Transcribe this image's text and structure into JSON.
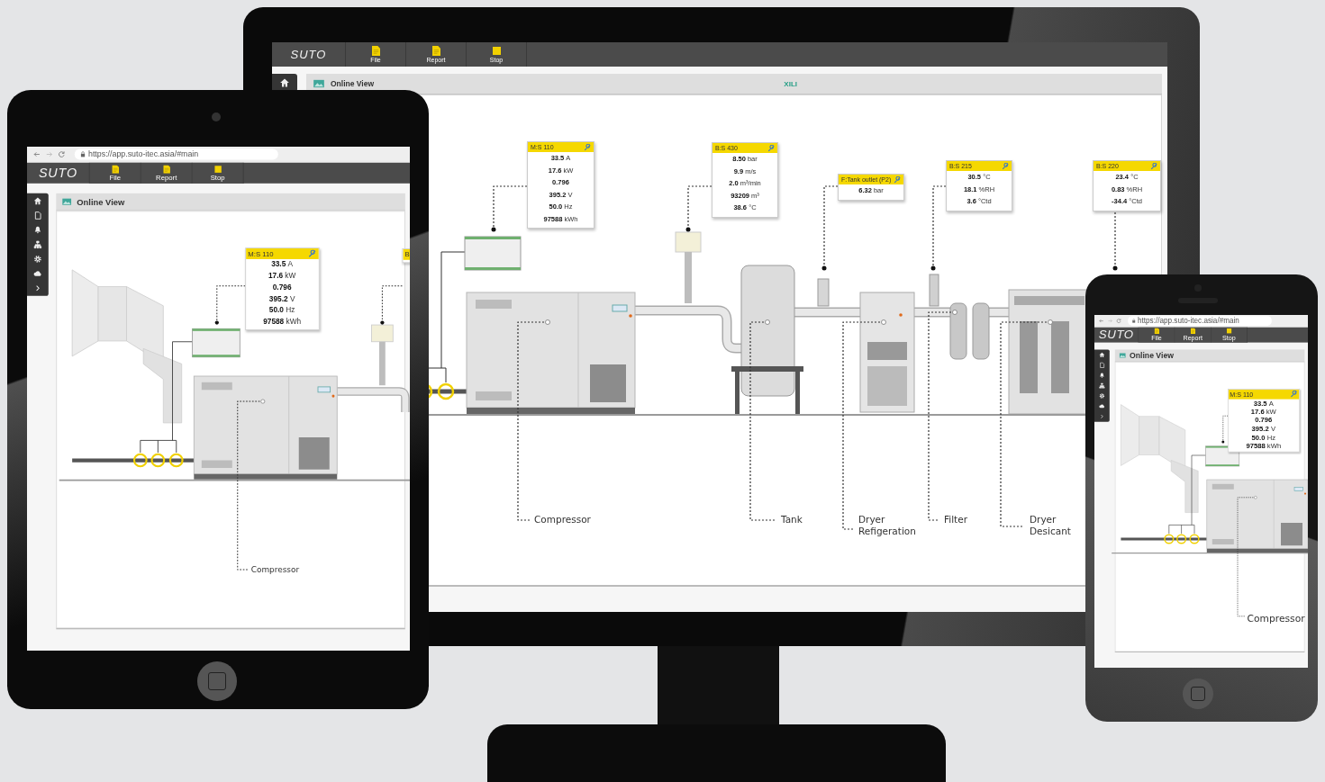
{
  "monitor": {
    "toolbar": {
      "logo": "SUTO",
      "buttons": [
        {
          "label": "File",
          "kind": "file"
        },
        {
          "label": "Report",
          "kind": "report"
        },
        {
          "label": "Stop",
          "kind": "stop"
        }
      ]
    },
    "breadcrumb": {
      "title": "Online View",
      "tag": "XILI"
    },
    "sensor_cards": [
      {
        "title": "M:S 110",
        "readings": [
          {
            "value": "33.5",
            "unit": "A"
          },
          {
            "value": "17.6",
            "unit": "kW"
          },
          {
            "value": "0.796"
          },
          {
            "value": "395.2",
            "unit": "V"
          },
          {
            "value": "50.0",
            "unit": "Hz"
          },
          {
            "value": "97588",
            "unit": "kWh"
          }
        ]
      },
      {
        "title": "B:S 430",
        "readings": [
          {
            "value": "8.50",
            "unit": "bar"
          },
          {
            "value": "9.9",
            "unit": "m/s"
          },
          {
            "value": "2.0",
            "unit": "m³/min"
          },
          {
            "value": "93209",
            "unit": "m³"
          },
          {
            "value": "38.6",
            "unit": "°C"
          }
        ]
      },
      {
        "title": "F:Tank outlet (P2)",
        "readings": [
          {
            "value": "6.32",
            "unit": "bar"
          }
        ]
      },
      {
        "title": "B:S 215",
        "readings": [
          {
            "value": "30.5",
            "unit": "°C"
          },
          {
            "value": "18.1",
            "unit": "%RH"
          },
          {
            "value": "3.6",
            "unit": "°Ctd"
          }
        ]
      },
      {
        "title": "B:S 220",
        "readings": [
          {
            "value": "23.4",
            "unit": "°C"
          },
          {
            "value": "0.83",
            "unit": "%RH"
          },
          {
            "value": "-34.4",
            "unit": "°Ctd"
          }
        ]
      }
    ],
    "equipment_labels": [
      "Compressor",
      "Tank",
      "Dryer Refigeration",
      "Filter",
      "Dryer Desicant"
    ]
  },
  "tablet": {
    "url": "https://app.suto-itec.asia/#main",
    "toolbar": {
      "logo": "SUTO",
      "buttons": [
        {
          "label": "File",
          "kind": "file"
        },
        {
          "label": "Report",
          "kind": "report"
        },
        {
          "label": "Stop",
          "kind": "stop"
        }
      ]
    },
    "breadcrumb": {
      "title": "Online View"
    },
    "sensor_cards": [
      {
        "title": "M:S 110",
        "readings": [
          {
            "value": "33.5",
            "unit": "A"
          },
          {
            "value": "17.6",
            "unit": "kW"
          },
          {
            "value": "0.796"
          },
          {
            "value": "395.2",
            "unit": "V"
          },
          {
            "value": "50.0",
            "unit": "Hz"
          },
          {
            "value": "97588",
            "unit": "kWh"
          }
        ]
      },
      {
        "title": "B"
      }
    ],
    "equipment_labels": [
      "Compressor"
    ]
  },
  "phone": {
    "url": "https://app.suto-itec.asia/#main",
    "toolbar": {
      "logo": "SUTO",
      "buttons": [
        {
          "label": "File",
          "kind": "file"
        },
        {
          "label": "Report",
          "kind": "report"
        },
        {
          "label": "Stop",
          "kind": "stop"
        }
      ]
    },
    "breadcrumb": {
      "title": "Online View"
    },
    "sensor_cards": [
      {
        "title": "M:S 110",
        "readings": [
          {
            "value": "33.5",
            "unit": "A"
          },
          {
            "value": "17.6",
            "unit": "kW"
          },
          {
            "value": "0.796"
          },
          {
            "value": "395.2",
            "unit": "V"
          },
          {
            "value": "50.0",
            "unit": "Hz"
          },
          {
            "value": "97588",
            "unit": "kWh"
          }
        ]
      }
    ],
    "equipment_labels": [
      "Compressor"
    ]
  }
}
